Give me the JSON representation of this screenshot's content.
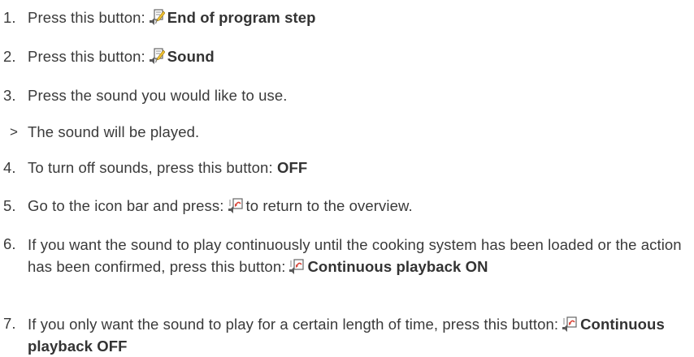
{
  "steps": [
    {
      "num": "1.",
      "pre": "Press this button:",
      "bold": "End of program step",
      "post": ""
    },
    {
      "num": "2.",
      "pre": "Press this button:",
      "bold": "Sound",
      "post": ""
    },
    {
      "num": "3.",
      "text": "Press the sound you would like to use."
    },
    {
      "mark": ">",
      "text": "The sound will be played."
    },
    {
      "num": "4.",
      "pre": "To turn off sounds, press this button:",
      "bold": "OFF"
    },
    {
      "num": "5.",
      "pre": "Go to the icon bar and press:",
      "post": "to return to the overview."
    },
    {
      "num": "6.",
      "pre": "If you want the sound to play continuously until the cooking system has been loaded or the action has been confirmed, press this button:",
      "bold": "Continuous playback ON"
    },
    {
      "num": "7.",
      "pre": "If you only want the sound to play for a certain length of time, press this button:",
      "bold": "Continuous playback OFF"
    }
  ],
  "icons": {
    "program_step": "speaker-with-note-pencil-icon",
    "return": "speaker-with-return-arrow-icon"
  },
  "colors": {
    "text": "#3a3a3a",
    "icon_pencil": "#f2c230",
    "icon_arrow": "#d9473a",
    "icon_speaker": "#5a5a5a"
  }
}
